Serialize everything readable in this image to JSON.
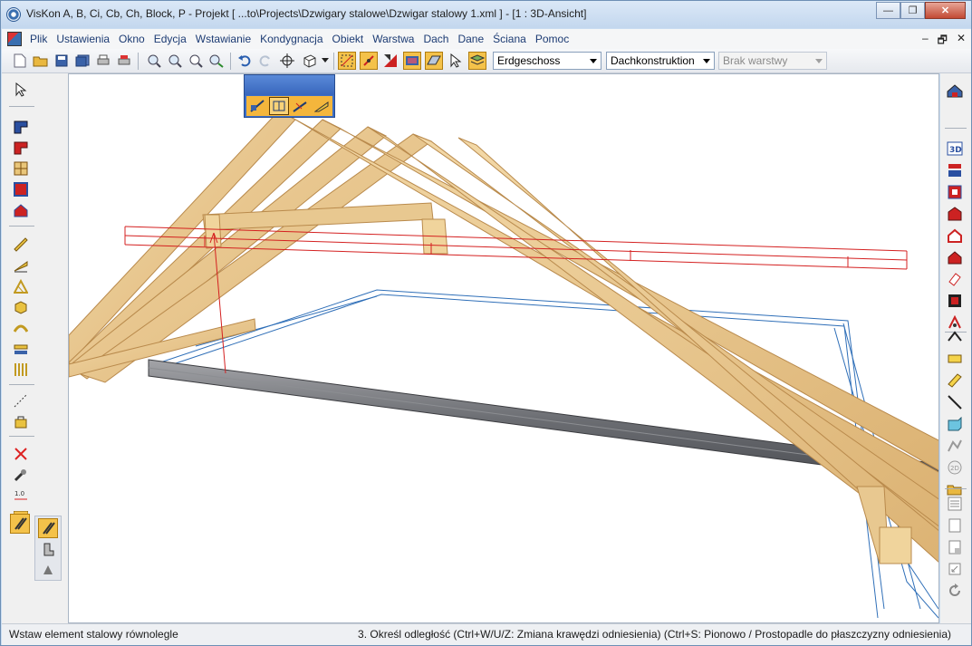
{
  "window": {
    "title": "VisKon A, B, Ci, Cb, Ch, Block, P - Projekt [ ...to\\Projects\\Dzwigary stalowe\\Dzwigar stalowy 1.xml ]  - [1 : 3D-Ansicht]",
    "minimize_label": "—",
    "maximize_label": "❐",
    "close_label": "✕"
  },
  "menubar": {
    "items": [
      "Plik",
      "Ustawienia",
      "Okno",
      "Edycja",
      "Wstawianie",
      "Kondygnacja",
      "Obiekt",
      "Warstwa",
      "Dach",
      "Dane",
      "Ściana",
      "Pomoc"
    ],
    "mdi_minimize": "–",
    "mdi_restore": "🗗",
    "mdi_close": "✕"
  },
  "toolbar": {
    "storey_value": "Erdgeschoss",
    "construction_value": "Dachkonstruktion",
    "layer_value": "Brak warstwy"
  },
  "statusbar": {
    "left_text": "Wstaw element stalowy równolegle",
    "right_text": "3. Określ odległość (Ctrl+W/U/Z: Zmiana krawędzi odniesienia) (Ctrl+S: Pionowo / Prostopadle do płaszczyzny odniesienia)"
  },
  "colors": {
    "timber": "#e8c890",
    "timber_edge": "#b98a4c",
    "steel_red": "#d42020",
    "steel_gray": "#6b6d72",
    "outline_blue": "#2f6fb8",
    "active_tool": "#f4c24a",
    "palette_blue": "#3b6ec7"
  }
}
